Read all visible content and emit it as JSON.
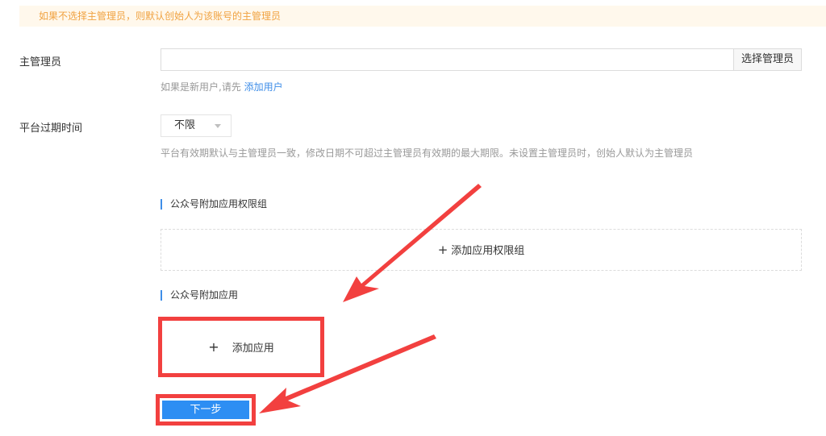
{
  "notice": "如果不选择主管理员，则默认创始人为该账号的主管理员",
  "admin": {
    "label": "主管理员",
    "input_value": "",
    "select_button": "选择管理员",
    "hint_prefix": "如果是新用户,请先 ",
    "hint_link": "添加用户"
  },
  "expire": {
    "label": "平台过期时间",
    "selected": "不限",
    "hint": "平台有效期默认与主管理员一致，修改日期不可超过主管理员有效期的最大期限。未设置主管理员时，创始人默认为主管理员"
  },
  "permission_group": {
    "title": "公众号附加应用权限组",
    "add_label": "添加应用权限组"
  },
  "extra_apps": {
    "title": "公众号附加应用",
    "add_label": "添加应用"
  },
  "next_button": "下一步",
  "colors": {
    "accent": "#2d8ef3",
    "link": "#3f8ee8",
    "highlight": "#f2403f",
    "notice_text": "#f0a240"
  }
}
